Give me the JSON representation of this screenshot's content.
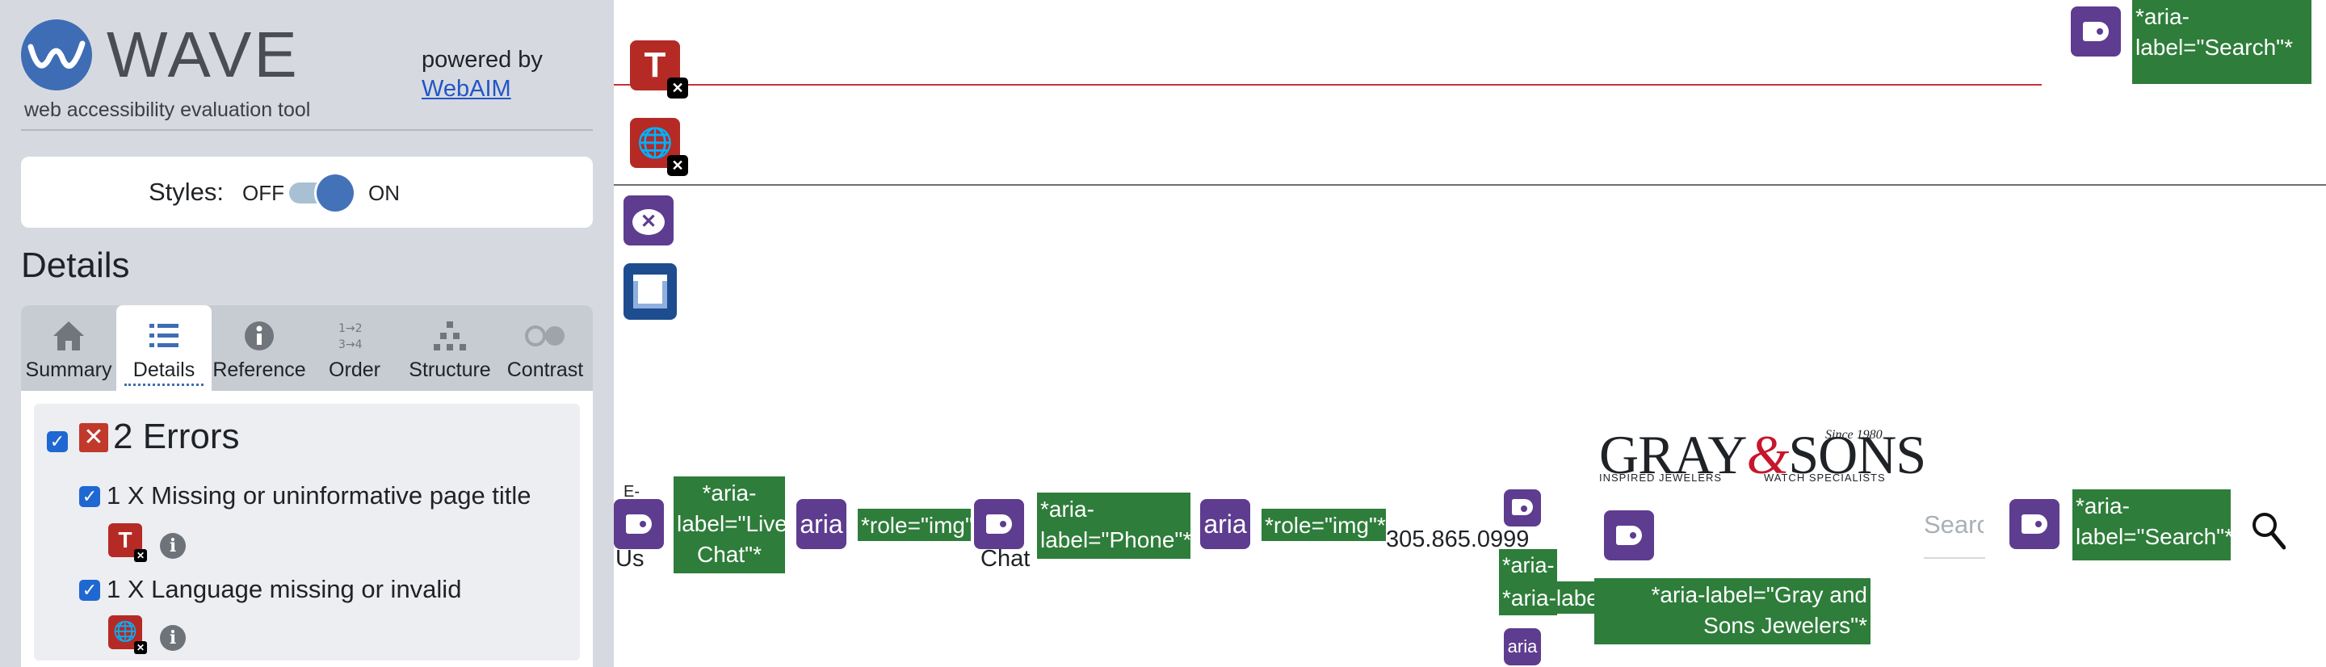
{
  "sidebar": {
    "logo_word": "WAVE",
    "tagline": "web accessibility evaluation tool",
    "powered_by": "powered by",
    "webaim_link": "WebAIM",
    "styles_label": "Styles:",
    "toggle_off": "OFF",
    "toggle_on": "ON",
    "toggle_state": "on",
    "details_heading": "Details",
    "tabs": [
      {
        "label": "Summary",
        "icon": "home-icon",
        "active": false
      },
      {
        "label": "Details",
        "icon": "list-icon",
        "active": true
      },
      {
        "label": "Reference",
        "icon": "info-icon",
        "active": false
      },
      {
        "label": "Order",
        "icon": "order-icon",
        "active": false
      },
      {
        "label": "Structure",
        "icon": "structure-icon",
        "active": false
      },
      {
        "label": "Contrast",
        "icon": "contrast-icon",
        "active": false
      }
    ],
    "errors": {
      "title": "2 Errors",
      "items": [
        {
          "label": "1 X Missing or uninformative page title",
          "icon_glyph": "T"
        },
        {
          "label": "1 X Language missing or invalid",
          "icon_glyph": "🌐"
        }
      ]
    }
  },
  "page": {
    "icons": {
      "page_title_error": "T",
      "language_error": "🌐"
    },
    "labels": {
      "search_top": "*aria-label=\"Search\"*",
      "live_chat": "*aria-label=\"Live Chat\"*",
      "role_img_1": "*role=\"img\"*",
      "phone": "*aria-label=\"Phone\"*",
      "role_img_2": "*role=\"img\"*",
      "language": "*aria-label=\"Language\"*",
      "gray_sons": "*aria-label=\"Gray and Sons Jewelers\"*",
      "search_bottom": "*aria-label=\"Search\"*"
    },
    "texts": {
      "email_us_top": "E-",
      "email_us_bottom": "Us",
      "chat": "Chat",
      "phone_number": "305.865.0999",
      "search_placeholder": "Search",
      "aria": "aria"
    },
    "brand": {
      "gray": "GRAY",
      "amp": "&",
      "sons": "SONS",
      "since": "Since 1980",
      "sub_left": "INSPIRED JEWELERS",
      "sub_right": "WATCH SPECIALISTS"
    }
  },
  "colors": {
    "wave_blue": "#3e6db5",
    "error_red": "#b52a24",
    "aria_purple": "#5e3c8f",
    "label_green": "#2e7d3a",
    "sidebar_bg": "#d6dae0"
  }
}
